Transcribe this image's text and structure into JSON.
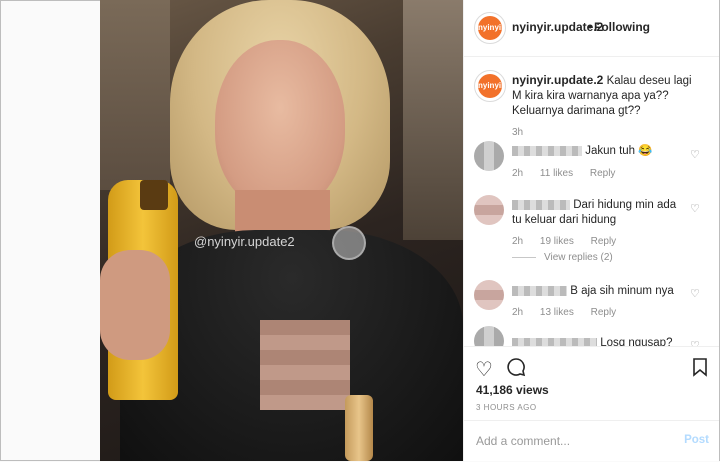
{
  "video": {
    "watermark": "@nyinyir.update2"
  },
  "header": {
    "username": "nyinyir.update.2",
    "separator": "•",
    "follow_state": "Following",
    "avatar_text": "nyinyir"
  },
  "caption": {
    "username": "nyinyir.update.2",
    "text": "Kalau deseu lagi M kira kira warnanya apa ya?? Keluarnya darimana gt??",
    "time": "3h"
  },
  "comments": [
    {
      "text": "Jakun tuh 😂",
      "time": "2h",
      "likes": "11 likes",
      "reply": "Reply"
    },
    {
      "text": "Dari hidung min ada tu keluar dari hidung",
      "time": "2h",
      "likes": "19 likes",
      "reply": "Reply",
      "view_replies": "View replies (2)"
    },
    {
      "text": "B aja sih minum nya",
      "time": "2h",
      "likes": "13 likes",
      "reply": "Reply"
    },
    {
      "text": "Losq ngusap?"
    }
  ],
  "actions": {
    "like_icon": "heart-icon",
    "comment_icon": "comment-icon",
    "save_icon": "bookmark-icon",
    "views": "41,186 views",
    "posted_ago": "3 HOURS AGO"
  },
  "add_comment": {
    "placeholder": "Add a comment...",
    "post_label": "Post"
  }
}
